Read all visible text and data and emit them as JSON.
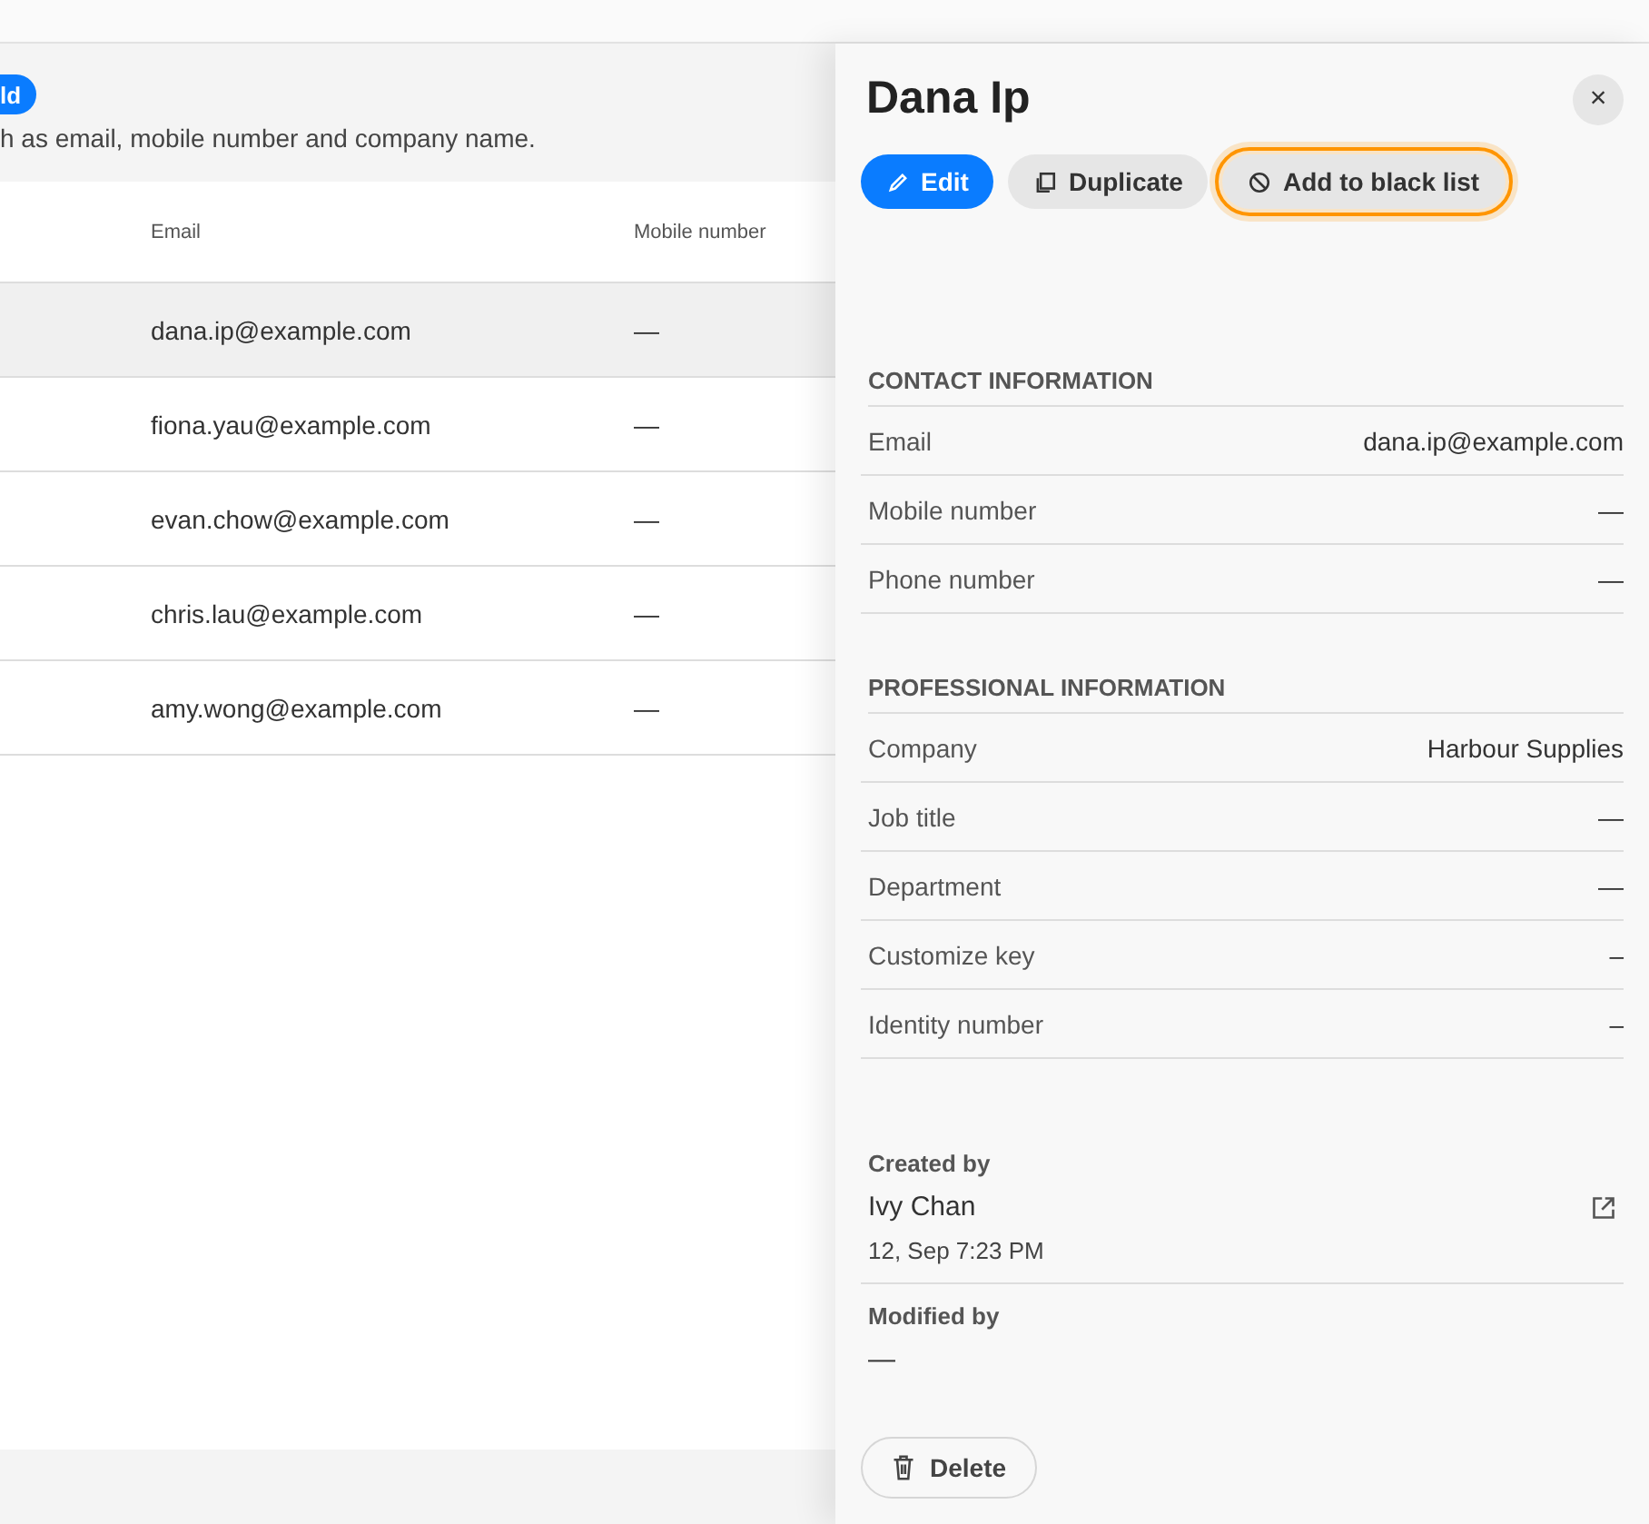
{
  "page": {
    "add_button": "ld",
    "description": "h as email, mobile number and company name."
  },
  "table": {
    "columns": [
      "Email",
      "Mobile number"
    ],
    "rows": [
      {
        "email": "dana.ip@example.com",
        "mobile": "—",
        "selected": true
      },
      {
        "email": "fiona.yau@example.com",
        "mobile": "—",
        "selected": false
      },
      {
        "email": "evan.chow@example.com",
        "mobile": "—",
        "selected": false
      },
      {
        "email": "chris.lau@example.com",
        "mobile": "—",
        "selected": false
      },
      {
        "email": "amy.wong@example.com",
        "mobile": "—",
        "selected": false
      }
    ]
  },
  "drawer": {
    "title": "Dana Ip",
    "close": "×",
    "actions": [
      {
        "kind": "primary",
        "label": "Edit",
        "focused": false
      },
      {
        "kind": "secondary",
        "label": "Duplicate",
        "focused": false
      },
      {
        "kind": "secondary",
        "label": "Add to black list",
        "focused": true
      }
    ],
    "sections": [
      {
        "title": "CONTACT INFORMATION",
        "fields": [
          {
            "label": "Email",
            "value": "dana.ip@example.com"
          },
          {
            "label": "Mobile number",
            "value": "—"
          },
          {
            "label": "Phone number",
            "value": "—"
          }
        ]
      },
      {
        "title": "PROFESSIONAL INFORMATION",
        "fields": [
          {
            "label": "Company",
            "value": "Harbour Supplies"
          },
          {
            "label": "Job title",
            "value": "—"
          },
          {
            "label": "Department",
            "value": "—"
          },
          {
            "label": "Customize key",
            "value": "–"
          },
          {
            "label": "Identity number",
            "value": "–"
          }
        ]
      }
    ],
    "created": {
      "label": "Created by",
      "name": "Ivy Chan",
      "time": "12, Sep 7:23 PM"
    },
    "modified": {
      "label": "Modified by",
      "name": "—"
    },
    "delete": "Delete"
  }
}
